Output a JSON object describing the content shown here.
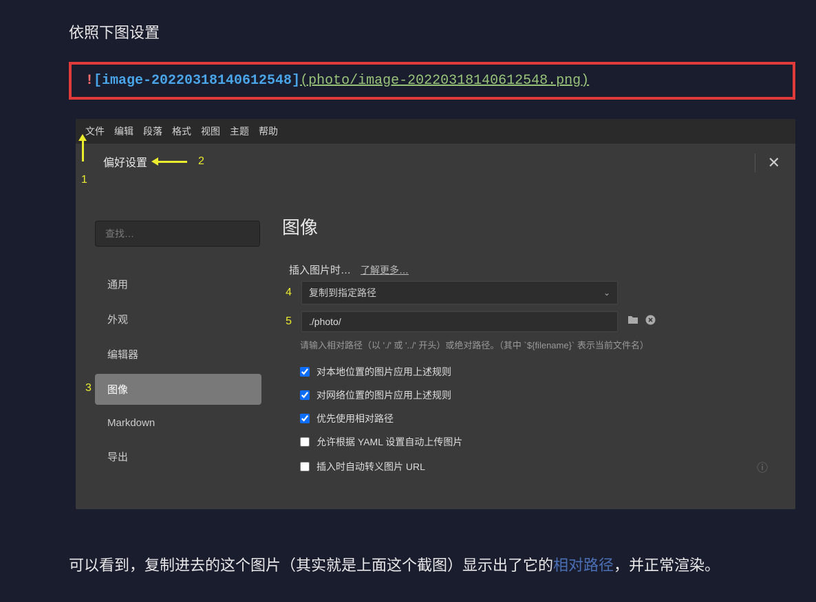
{
  "intro": "依照下图设置",
  "code": {
    "bang": "!",
    "alt": "[image-20220318140612548]",
    "path": "(photo/image-20220318140612548.png)"
  },
  "menubar": {
    "items": [
      "文件",
      "编辑",
      "段落",
      "格式",
      "视图",
      "主题",
      "帮助"
    ]
  },
  "titlebar": {
    "title": "偏好设置"
  },
  "annotations": {
    "n1": "1",
    "n2": "2",
    "n3": "3",
    "n4": "4",
    "n5": "5"
  },
  "sidebar": {
    "search_placeholder": "查找…",
    "items": [
      {
        "label": "通用",
        "active": false
      },
      {
        "label": "外观",
        "active": false
      },
      {
        "label": "编辑器",
        "active": false
      },
      {
        "label": "图像",
        "active": true
      },
      {
        "label": "Markdown",
        "active": false
      },
      {
        "label": "导出",
        "active": false
      }
    ]
  },
  "content": {
    "title": "图像",
    "insert_label": "插入图片时…",
    "learn_more": "了解更多…",
    "select_value": "复制到指定路径",
    "path_value": "./photo/",
    "hint": "请输入相对路径（以 './' 或 '../' 开头）或绝对路径。（其中 `${filename}` 表示当前文件名）",
    "checkboxes": [
      {
        "label": "对本地位置的图片应用上述规则",
        "checked": true
      },
      {
        "label": "对网络位置的图片应用上述规则",
        "checked": true
      },
      {
        "label": "优先使用相对路径",
        "checked": true
      },
      {
        "label": "允许根据 YAML 设置自动上传图片",
        "checked": false
      },
      {
        "label": "插入时自动转义图片 URL",
        "checked": false
      }
    ]
  },
  "outro": {
    "p1": "可以看到，复制进去的这个图片（其实就是上面这个截图）显示出了它的",
    "link": "相对路径",
    "p2": "，并正常渲染。"
  }
}
